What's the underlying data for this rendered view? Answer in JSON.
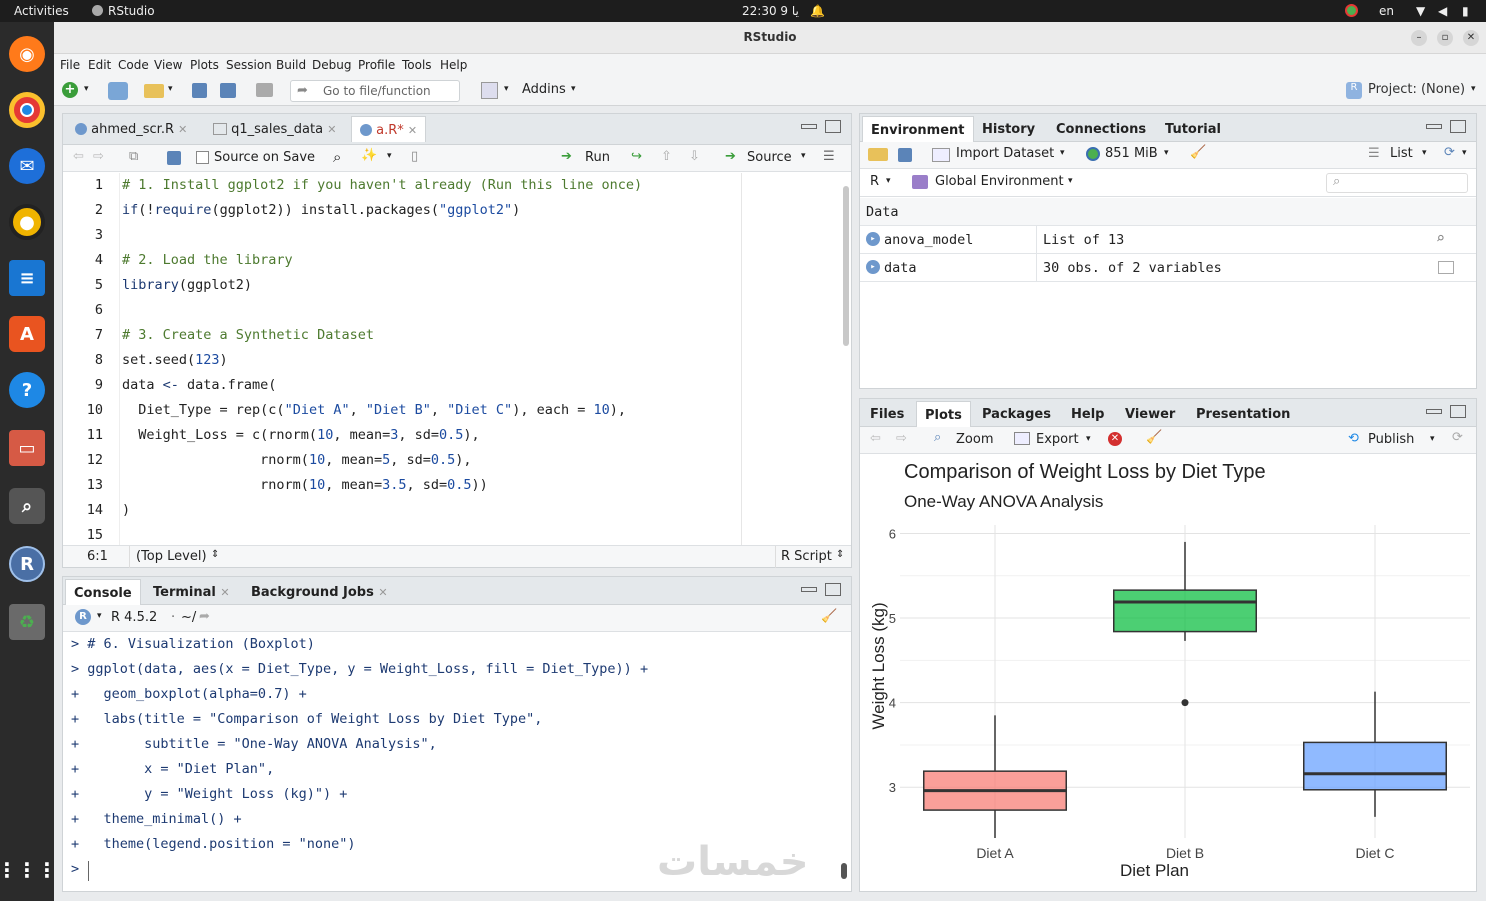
{
  "topbar": {
    "activities": "Activities",
    "app": "RStudio",
    "clock": "22:30 يا 9",
    "lang": "en"
  },
  "window": {
    "title": "RStudio"
  },
  "menu": [
    "File",
    "Edit",
    "Code",
    "View",
    "Plots",
    "Session",
    "Build",
    "Debug",
    "Profile",
    "Tools",
    "Help"
  ],
  "toolbar": {
    "goto_placeholder": "Go to file/function",
    "addins": "Addins",
    "project": "Project: (None)"
  },
  "source": {
    "tabs": [
      {
        "label": "ahmed_scr.R"
      },
      {
        "label": "q1_sales_data"
      },
      {
        "label": "a.R*"
      }
    ],
    "toolbar": {
      "source_on_save": "Source on Save",
      "run": "Run",
      "source": "Source"
    },
    "lines": [
      {
        "n": "1",
        "html": "<span class='cm'># 1. Install ggplot2 if you haven't already (Run this line once)</span>"
      },
      {
        "n": "2",
        "html": "<span class='fn'>if</span>(!<span class='fn'>require</span>(ggplot2)) install.packages(<span class='st'>\"ggplot2\"</span>)"
      },
      {
        "n": "3",
        "html": ""
      },
      {
        "n": "4",
        "html": "<span class='cm'># 2. Load the library</span>"
      },
      {
        "n": "5",
        "html": "<span class='fn'>library</span>(ggplot2)"
      },
      {
        "n": "6",
        "html": ""
      },
      {
        "n": "7",
        "html": "<span class='cm'># 3. Create a Synthetic Dataset</span>"
      },
      {
        "n": "8",
        "html": "set.seed(<span class='nm'>123</span>)"
      },
      {
        "n": "9",
        "html": "data <span class='kw'>&lt;-</span> data.frame("
      },
      {
        "n": "10",
        "html": "  Diet_Type = rep(c(<span class='st'>\"Diet A\"</span>, <span class='st'>\"Diet B\"</span>, <span class='st'>\"Diet C\"</span>), each = <span class='nm'>10</span>),"
      },
      {
        "n": "11",
        "html": "  Weight_Loss = c(rnorm(<span class='nm'>10</span>, mean=<span class='nm'>3</span>, sd=<span class='nm'>0.5</span>),"
      },
      {
        "n": "12",
        "html": "                 rnorm(<span class='nm'>10</span>, mean=<span class='nm'>5</span>, sd=<span class='nm'>0.5</span>),"
      },
      {
        "n": "13",
        "html": "                 rnorm(<span class='nm'>10</span>, mean=<span class='nm'>3.5</span>, sd=<span class='nm'>0.5</span>))"
      },
      {
        "n": "14",
        "html": ")"
      },
      {
        "n": "15",
        "html": ""
      }
    ],
    "status": {
      "position": "6:1",
      "scope": "(Top Level)",
      "type": "R Script"
    }
  },
  "console": {
    "tabs": [
      {
        "label": "Console"
      },
      {
        "label": "Terminal"
      },
      {
        "label": "Background Jobs"
      }
    ],
    "version": "R 4.5.2",
    "path": "~/",
    "lines": [
      "> # 6. Visualization (Boxplot)",
      "> ggplot(data, aes(x = Diet_Type, y = Weight_Loss, fill = Diet_Type)) +",
      "+   geom_boxplot(alpha=0.7) +",
      "+   labs(title = \"Comparison of Weight Loss by Diet Type\",",
      "+        subtitle = \"One-Way ANOVA Analysis\",",
      "+        x = \"Diet Plan\",",
      "+        y = \"Weight Loss (kg)\") +",
      "+   theme_minimal() +",
      "+   theme(legend.position = \"none\")",
      ">"
    ],
    "watermark": "خمسات"
  },
  "env": {
    "tabs": [
      {
        "label": "Environment"
      },
      {
        "label": "History"
      },
      {
        "label": "Connections"
      },
      {
        "label": "Tutorial"
      }
    ],
    "toolbar": {
      "import": "Import Dataset",
      "memory": "851 MiB",
      "view": "List"
    },
    "lang": "R",
    "scope": "Global Environment",
    "section": "Data",
    "rows": [
      {
        "name": "anova_model",
        "value": "List of  13"
      },
      {
        "name": "data",
        "value": "30 obs. of 2 variables"
      }
    ]
  },
  "files": {
    "tabs": [
      {
        "label": "Files"
      },
      {
        "label": "Plots"
      },
      {
        "label": "Packages"
      },
      {
        "label": "Help"
      },
      {
        "label": "Viewer"
      },
      {
        "label": "Presentation"
      }
    ],
    "toolbar": {
      "zoom": "Zoom",
      "export": "Export",
      "publish": "Publish"
    }
  },
  "chart_data": {
    "type": "box",
    "title": "Comparison of Weight Loss by Diet Type",
    "subtitle": "One-Way ANOVA Analysis",
    "xlabel": "Diet Plan",
    "ylabel": "Weight Loss (kg)",
    "ylim": [
      2.4,
      6.1
    ],
    "yticks": [
      3,
      4,
      5,
      6
    ],
    "categories": [
      "Diet A",
      "Diet B",
      "Diet C"
    ],
    "boxes": [
      {
        "category": "Diet A",
        "min": 2.4,
        "q1": 2.73,
        "median": 2.96,
        "q3": 3.19,
        "max": 3.85,
        "outliers": [],
        "color": "#f8766d"
      },
      {
        "category": "Diet B",
        "min": 4.73,
        "q1": 4.84,
        "median": 5.19,
        "q3": 5.33,
        "max": 5.9,
        "outliers": [
          4.0
        ],
        "color": "#00ba38"
      },
      {
        "category": "Diet C",
        "min": 2.65,
        "q1": 2.97,
        "median": 3.16,
        "q3": 3.53,
        "max": 4.13,
        "outliers": [],
        "color": "#619cff"
      }
    ],
    "grid": true,
    "legend": "none"
  }
}
